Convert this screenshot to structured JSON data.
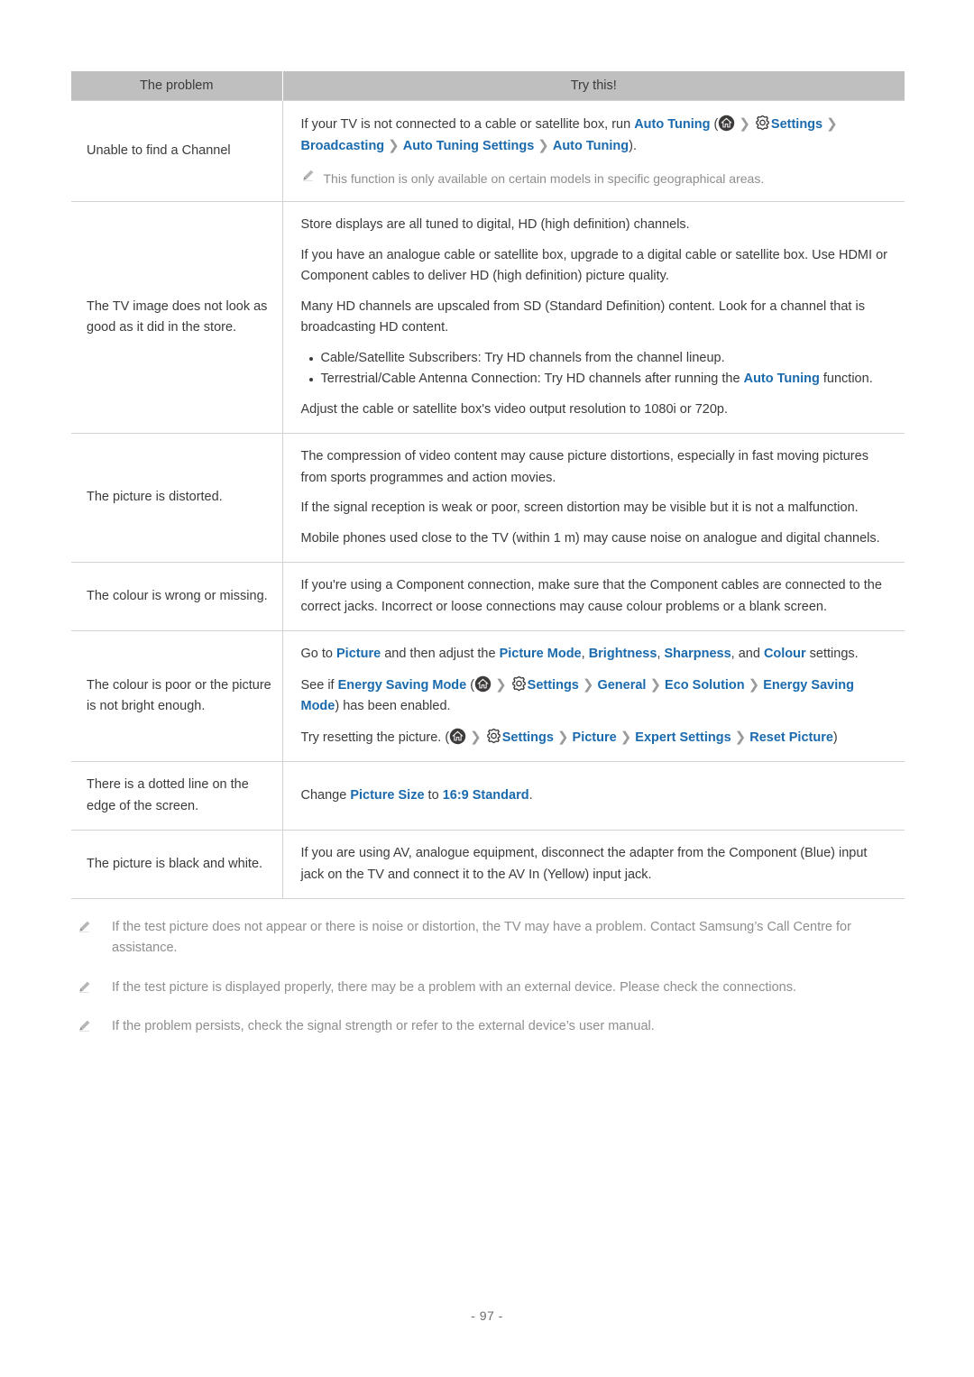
{
  "document": {
    "page_number": "- 97 -"
  },
  "table": {
    "headers": [
      "The problem",
      "Try this!"
    ],
    "rows": [
      {
        "problem": "Unable to find a Channel",
        "solution_id": "unable-to-find-channel"
      },
      {
        "problem": "The TV image does not look as good as it did in the store.",
        "solution_id": "tv-image-not-good"
      },
      {
        "problem": "The picture is distorted.",
        "solution_id": "picture-distorted"
      },
      {
        "problem": "The colour is wrong or missing.",
        "solution_id": "colour-wrong-missing"
      },
      {
        "problem": "The colour is poor or the picture is not bright enough.",
        "solution_id": "colour-poor"
      },
      {
        "problem": "There is a dotted line on the edge of the screen.",
        "solution_id": "dotted-line"
      },
      {
        "problem": "The picture is black and white.",
        "solution_id": "black-and-white"
      }
    ]
  },
  "row1": {
    "text_a": "If your TV is not connected to a cable or satellite box, run ",
    "link_auto_tuning": "Auto Tuning",
    "open_paren": " (",
    "link_settings": "Settings",
    "link_broadcasting": "Broadcasting",
    "link_auto_tuning_settings": "Auto Tuning Settings",
    "link_auto_tuning_2": "Auto Tuning",
    "close_paren": ").",
    "note": "This function is only available on certain models in specific geographical areas."
  },
  "row2": {
    "p1": "Store displays are all tuned to digital, HD (high definition) channels.",
    "p2": "If you have an analogue cable or satellite box, upgrade to a digital cable or satellite box. Use HDMI or Component cables to deliver HD (high definition) picture quality.",
    "p3": "Many HD channels are upscaled from SD (Standard Definition) content. Look for a channel that is broadcasting HD content.",
    "bullet1": "Cable/Satellite Subscribers: Try HD channels from the channel lineup.",
    "bullet2_a": "Terrestrial/Cable Antenna Connection: Try HD channels after running the ",
    "bullet2_link": "Auto Tuning",
    "bullet2_b": " function.",
    "p4": "Adjust the cable or satellite box's video output resolution to 1080i or 720p."
  },
  "row3": {
    "p1": "The compression of video content may cause picture distortions, especially in fast moving pictures from sports programmes and action movies.",
    "p2": "If the signal reception is weak or poor, screen distortion may be visible but it is not a malfunction.",
    "p3": "Mobile phones used close to the TV (within 1 m) may cause noise on analogue and digital channels."
  },
  "row4": {
    "p1": "If you're using a Component connection, make sure that the Component cables are connected to the correct jacks. Incorrect or loose connections may cause colour problems or a blank screen."
  },
  "row5": {
    "p1_a": "Go to ",
    "p1_link_picture": "Picture",
    "p1_b": " and then adjust the ",
    "p1_link_picture_mode": "Picture Mode",
    "p1_c": ", ",
    "p1_link_brightness": "Brightness",
    "p1_d": ", ",
    "p1_link_sharpness": "Sharpness",
    "p1_e": ", and ",
    "p1_link_colour": "Colour",
    "p1_f": " settings.",
    "p2_a": "See if ",
    "p2_link_energy_saving_mode": "Energy Saving Mode",
    "p2_open": " (",
    "p2_link_settings": "Settings",
    "p2_link_general": "General",
    "p2_link_eco_solution": "Eco Solution",
    "p2_link_energy_saving_mode2": "Energy Saving Mode",
    "p2_close": ") has been enabled.",
    "p3_a": "Try resetting the picture. (",
    "p3_link_settings": "Settings",
    "p3_link_picture": "Picture",
    "p3_link_expert_settings": "Expert Settings",
    "p3_link_reset_picture": "Reset Picture",
    "p3_close": ")"
  },
  "row6": {
    "p1_a": "Change ",
    "p1_link_picture_size": "Picture Size",
    "p1_b": " to ",
    "p1_link_169": "16:9 Standard",
    "p1_c": "."
  },
  "row7": {
    "p1": "If you are using AV, analogue equipment, disconnect the adapter from the Component (Blue) input jack on the TV and connect it to the AV In (Yellow) input jack."
  },
  "notes": [
    "If the test picture does not appear or there is noise or distortion, the TV may have a problem. Contact Samsung’s Call Centre for assistance.",
    "If the test picture is displayed properly, there may be a problem with an external device. Please check the connections.",
    "If the problem persists, check the signal strength or refer to the external device’s user manual."
  ],
  "icons": {
    "home": "home-icon",
    "gear": "gear-icon",
    "pencil": "pencil-note-icon",
    "chevron": "chevron-right-separator"
  },
  "colors": {
    "link_blue": "#1a6aad",
    "header_gray": "#bfbfbf",
    "body_text": "#3d3a3a",
    "note_gray": "#8f8d8d",
    "border": "#d2d2d2"
  }
}
